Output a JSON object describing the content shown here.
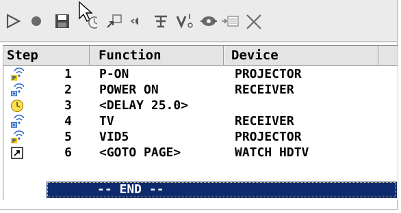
{
  "toolbar": {
    "buttons": [
      {
        "name": "play",
        "icon": "play-icon"
      },
      {
        "name": "record",
        "icon": "record-icon"
      },
      {
        "name": "save",
        "icon": "save-icon"
      },
      {
        "name": "delay",
        "icon": "delay-clock-icon"
      },
      {
        "name": "goto",
        "icon": "goto-page-icon"
      },
      {
        "name": "volume",
        "icon": "speaker-icon"
      },
      {
        "name": "text",
        "icon": "text-icon"
      },
      {
        "name": "variable",
        "icon": "variable-icon"
      },
      {
        "name": "macro",
        "icon": "macro-icon"
      },
      {
        "name": "insert",
        "icon": "insert-icon"
      },
      {
        "name": "delete",
        "icon": "delete-x-icon"
      }
    ]
  },
  "table": {
    "columns": [
      "Step",
      "Function",
      "Device"
    ],
    "rows": [
      {
        "icon": "ir-signal-projector-icon",
        "step": "1",
        "function": "P-ON",
        "device": "PROJECTOR"
      },
      {
        "icon": "ir-signal-receiver-icon",
        "step": "2",
        "function": "POWER ON",
        "device": "RECEIVER"
      },
      {
        "icon": "clock-icon",
        "step": "3",
        "function": "<DELAY 25.0>",
        "device": ""
      },
      {
        "icon": "ir-signal-receiver-icon",
        "step": "4",
        "function": "TV",
        "device": "RECEIVER"
      },
      {
        "icon": "ir-signal-projector-icon",
        "step": "5",
        "function": "VID5",
        "device": "PROJECTOR"
      },
      {
        "icon": "goto-arrow-icon",
        "step": "6",
        "function": "<GOTO PAGE>",
        "device": "WATCH HDTV"
      }
    ],
    "end_label": "-- END --"
  },
  "colors": {
    "selection": "#0e2b6e",
    "toolbar_bg": "#ebebeb",
    "header_bg": "#e4e4e4"
  }
}
